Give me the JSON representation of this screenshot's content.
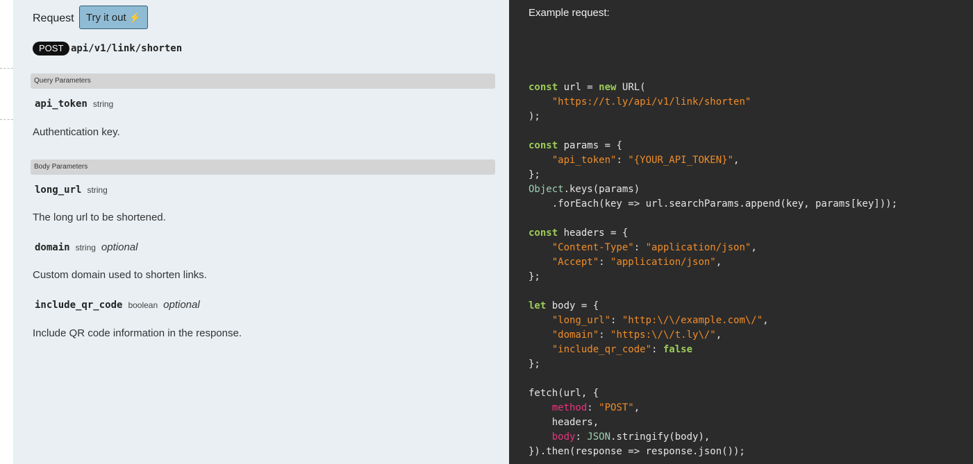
{
  "request": {
    "label": "Request",
    "try_button": {
      "label": "Try it out",
      "icon": "lightning-bolt-icon"
    },
    "method": "POST",
    "endpoint": "api/v1/link/shorten"
  },
  "query_parameters": {
    "title": "Query Parameters",
    "params": [
      {
        "name": "api_token",
        "type": "string",
        "optional": "",
        "description": "Authentication key."
      }
    ]
  },
  "body_parameters": {
    "title": "Body Parameters",
    "params": [
      {
        "name": "long_url",
        "type": "string",
        "optional": "",
        "description": "The long url to be shortened."
      },
      {
        "name": "domain",
        "type": "string",
        "optional": "optional",
        "description": "Custom domain used to shorten links."
      },
      {
        "name": "include_qr_code",
        "type": "boolean",
        "optional": "optional",
        "description": "Include QR code information in the response."
      }
    ]
  },
  "example": {
    "label": "Example request:",
    "code": {
      "url": "\"https://t.ly/api/v1/link/shorten\"",
      "api_token_key": "\"api_token\"",
      "api_token_val": "\"{YOUR_API_TOKEN}\"",
      "content_type_key": "\"Content-Type\"",
      "content_type_val": "\"application/json\"",
      "accept_key": "\"Accept\"",
      "accept_val": "\"application/json\"",
      "long_url_key": "\"long_url\"",
      "long_url_val": "\"http:\\/\\/example.com\\/\"",
      "domain_key": "\"domain\"",
      "domain_val": "\"https:\\/\\/t.ly\\/\"",
      "qr_key": "\"include_qr_code\"",
      "method_val": "\"POST\""
    }
  },
  "colors": {
    "left_bg": "#e9eff3",
    "code_bg": "#2b2b2b",
    "try_button_bg": "#8fbcd4",
    "keyword": "#9ccc5a",
    "string": "#f08d2a",
    "property": "#e8357c"
  }
}
